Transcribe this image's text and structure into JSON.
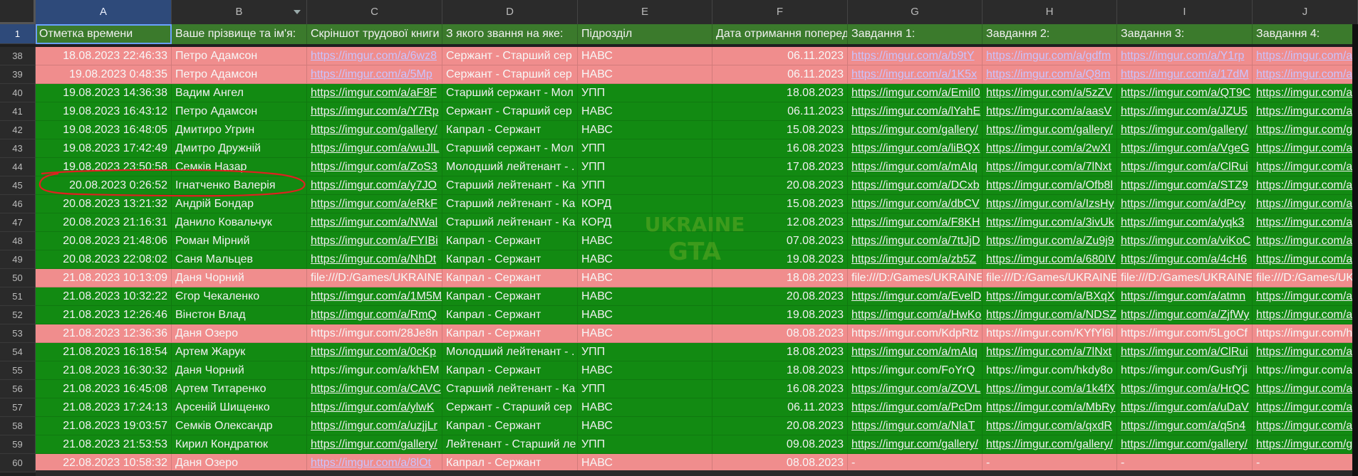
{
  "columns": [
    {
      "letter": "A",
      "selected": true,
      "filter": false
    },
    {
      "letter": "B",
      "selected": false,
      "filter": true
    },
    {
      "letter": "C",
      "selected": false,
      "filter": false
    },
    {
      "letter": "D",
      "selected": false,
      "filter": false
    },
    {
      "letter": "E",
      "selected": false,
      "filter": false
    },
    {
      "letter": "F",
      "selected": false,
      "filter": false
    },
    {
      "letter": "G",
      "selected": false,
      "filter": false
    },
    {
      "letter": "H",
      "selected": false,
      "filter": false
    },
    {
      "letter": "I",
      "selected": false,
      "filter": false
    },
    {
      "letter": "J",
      "selected": false,
      "filter": false
    }
  ],
  "header_row": {
    "num": "1",
    "cells": [
      "Отметка времени",
      "Ваше прізвище та ім'я:",
      "Скріншот трудової книги",
      "З якого звання на яке:",
      "Підрозділ",
      "Дата отримання поперед",
      "Завдання 1:",
      "Завдання 2:",
      "Завдання 3:",
      "Завдання 4:"
    ]
  },
  "colors": {
    "green": "#128a12",
    "pink": "#f08d8d",
    "header": "#3b7a2c",
    "annotation": "#e02020"
  },
  "rows": [
    {
      "num": "38",
      "status": "pink",
      "ts": "18.08.2023 22:46:33",
      "name": "Петро Адамсон",
      "c": "https://imgur.com/a/6wz8",
      "d": "Сержант - Старший сер",
      "e": "НАВС",
      "f": "06.11.2023",
      "g": "https://imgur.com/a/b9tY",
      "h": "https://imgur.com/a/gdfm",
      "i": "https://imgur.com/a/Y1rp",
      "j": "https://imgur.com/a/",
      "link": true
    },
    {
      "num": "39",
      "status": "pink",
      "ts": "19.08.2023 0:48:35",
      "name": "Петро Адамсон",
      "c": "https://imgur.com/a/5Mp",
      "d": "Сержант - Старший сер",
      "e": "НАВС",
      "f": "06.11.2023",
      "g": "https://imgur.com/a/1K5x",
      "h": "https://imgur.com/a/Q8m",
      "i": "https://imgur.com/a/17dM",
      "j": "https://imgur.com/a/",
      "link": true
    },
    {
      "num": "40",
      "status": "green",
      "ts": "19.08.2023 14:36:38",
      "name": "Вадим Ангел",
      "c": "https://imgur.com/a/aF8F",
      "d": "Старший сержант - Мол",
      "e": "УПП",
      "f": "18.08.2023",
      "g": "https://imgur.com/a/EmiI0",
      "h": "https://imgur.com/a/5zZV",
      "i": "https://imgur.com/a/QT9C",
      "j": "https://imgur.com/a/",
      "link": true
    },
    {
      "num": "41",
      "status": "green",
      "ts": "19.08.2023 16:43:12",
      "name": "Петро Адамсон",
      "c": "https://imgur.com/a/Y7Rp",
      "d": "Сержант - Старший сер",
      "e": "НАВС",
      "f": "06.11.2023",
      "g": "https://imgur.com/a/lYahE",
      "h": "https://imgur.com/a/aasV",
      "i": "https://imgur.com/a/JZU5",
      "j": "https://imgur.com/a/",
      "link": true
    },
    {
      "num": "42",
      "status": "green",
      "ts": "19.08.2023 16:48:05",
      "name": "Дмитиро Угрин",
      "c": "https://imgur.com/gallery/",
      "d": "Капрал - Сержант",
      "e": "НАВС",
      "f": "15.08.2023",
      "g": "https://imgur.com/gallery/",
      "h": "https://imgur.com/gallery/",
      "i": "https://imgur.com/gallery/",
      "j": "https://imgur.com/g",
      "link": true
    },
    {
      "num": "43",
      "status": "green",
      "ts": "19.08.2023 17:42:49",
      "name": "Дмитро Дружній",
      "c": "https://imgur.com/a/wuJlL",
      "d": "Старший сержант - Мол",
      "e": "УПП",
      "f": "16.08.2023",
      "g": "https://imgur.com/a/liBQX",
      "h": "https://imgur.com/a/2wXI",
      "i": "https://imgur.com/a/VgeG",
      "j": "https://imgur.com/a/",
      "link": true
    },
    {
      "num": "44",
      "status": "green",
      "ts": "19.08.2023 23:50:58",
      "name": "Семків Назар",
      "c": "https://imgur.com/a/ZoS3",
      "d": "Молодший лейтенант - .",
      "e": "УПП",
      "f": "17.08.2023",
      "g": "https://imgur.com/a/mAIq",
      "h": "https://imgur.com/a/7lNxt",
      "i": "https://imgur.com/a/ClRui",
      "j": "https://imgur.com/a/",
      "link": true
    },
    {
      "num": "45",
      "status": "green",
      "ts": "20.08.2023 0:26:52",
      "name": "Ігнатченко Валерія",
      "c": "https://imgur.com/a/y7JO",
      "d": "Старший лейтенант - Ка",
      "e": "УПП",
      "f": "20.08.2023",
      "g": "https://imgur.com/a/DCxb",
      "h": "https://imgur.com/a/Ofb8l",
      "i": "https://imgur.com/a/STZ9",
      "j": "https://imgur.com/a/",
      "link": true
    },
    {
      "num": "46",
      "status": "green",
      "ts": "20.08.2023 13:21:32",
      "name": "Андрій Бондар",
      "c": "https://imgur.com/a/eRkF",
      "d": "Старший лейтенант - Ка",
      "e": "КОРД",
      "f": "15.08.2023",
      "g": "https://imgur.com/a/dbCV",
      "h": "https://imgur.com/a/IzsHy",
      "i": "https://imgur.com/a/dPcy",
      "j": "https://imgur.com/a/",
      "link": true
    },
    {
      "num": "47",
      "status": "green",
      "ts": "20.08.2023 21:16:31",
      "name": "Данило Ковальчук",
      "c": "https://imgur.com/a/NWal",
      "d": "Старший лейтенант - Ка",
      "e": "КОРД",
      "f": "12.08.2023",
      "g": "https://imgur.com/a/F8KH",
      "h": "https://imgur.com/a/3ivUk",
      "i": "https://imgur.com/a/yqk3",
      "j": "https://imgur.com/a/",
      "link": true
    },
    {
      "num": "48",
      "status": "green",
      "ts": "20.08.2023 21:48:06",
      "name": "Роман Мірний",
      "c": "https://imgur.com/a/FYIBi",
      "d": "Капрал - Сержант",
      "e": "НАВС",
      "f": "07.08.2023",
      "g": "https://imgur.com/a/7ttJjD",
      "h": "https://imgur.com/a/Zu9j9",
      "i": "https://imgur.com/a/viKoC",
      "j": "https://imgur.com/a/",
      "link": true
    },
    {
      "num": "49",
      "status": "green",
      "ts": "20.08.2023 22:08:02",
      "name": "Саня Мальцев",
      "c": "https://imgur.com/a/NhDt",
      "d": "Капрал - Сержант",
      "e": "НАВС",
      "f": "19.08.2023",
      "g": "https://imgur.com/a/zb5Z",
      "h": "https://imgur.com/a/680IV",
      "i": "https://imgur.com/a/4cH6",
      "j": "https://imgur.com/a/",
      "link": true
    },
    {
      "num": "50",
      "status": "pink",
      "ts": "21.08.2023 10:13:09",
      "name": "Даня Чорний",
      "c": "file:///D:/Games/UKRAINE",
      "d": "Капрал - Сержант",
      "e": "НАВС",
      "f": "18.08.2023",
      "g": "file:///D:/Games/UKRAINE",
      "h": "file:///D:/Games/UKRAINE",
      "i": "file:///D:/Games/UKRAINE",
      "j": "file:///D:/Games/UK",
      "link": false
    },
    {
      "num": "51",
      "status": "green",
      "ts": "21.08.2023 10:32:22",
      "name": "Єгор Чекаленко",
      "c": "https://imgur.com/a/1M5M",
      "d": "Капрал - Сержант",
      "e": "НАВС",
      "f": "20.08.2023",
      "g": "https://imgur.com/a/EvelDp",
      "h": "https://imgur.com/a/BXqX",
      "i": "https://imgur.com/a/atmn",
      "j": "https://imgur.com/a/",
      "link": true
    },
    {
      "num": "52",
      "status": "green",
      "ts": "21.08.2023 12:26:46",
      "name": "Вінстон Влад",
      "c": "https://imgur.com/a/RmQ",
      "d": "Капрал - Сержант",
      "e": "НАВС",
      "f": "19.08.2023",
      "g": "https://imgur.com/a/HwKo",
      "h": "https://imgur.com/a/NDSZ",
      "i": "https://imgur.com/a/ZjfWy",
      "j": "https://imgur.com/a/",
      "link": true
    },
    {
      "num": "53",
      "status": "pink",
      "ts": "21.08.2023 12:36:36",
      "name": "Даня Озеро",
      "c": "https://imgur.com/28Je8n",
      "d": "Капрал - Сержант",
      "e": "НАВС",
      "f": "08.08.2023",
      "g": "https://imgur.com/KdpRtz",
      "h": "https://imgur.com/KYfYl6l",
      "i": "https://imgur.com/5LgoCf",
      "j": "https://imgur.com/h",
      "link": false
    },
    {
      "num": "54",
      "status": "green",
      "ts": "21.08.2023 16:18:54",
      "name": "Артем Жарук",
      "c": "https://imgur.com/a/0cKp",
      "d": "Молодший лейтенант - .",
      "e": "УПП",
      "f": "18.08.2023",
      "g": "https://imgur.com/a/mAIq",
      "h": "https://imgur.com/a/7lNxt",
      "i": "https://imgur.com/a/ClRui",
      "j": "https://imgur.com/a/",
      "link": true
    },
    {
      "num": "55",
      "status": "green",
      "ts": "21.08.2023 16:30:32",
      "name": "Даня Чорний",
      "c": "https://imgur.com/a/khEM",
      "d": "Капрал - Сержант",
      "e": "НАВС",
      "f": "18.08.2023",
      "g": "https://imgur.com/FoYrQ",
      "h": "https://imgur.com/hkdy8o",
      "i": "https://imgur.com/GusfYji",
      "j": "https://imgur.com/a/",
      "link": false
    },
    {
      "num": "56",
      "status": "green",
      "ts": "21.08.2023 16:45:08",
      "name": "Артем Титаренко",
      "c": "https://imgur.com/a/CAVC",
      "d": "Старший лейтенант - Ка",
      "e": "УПП",
      "f": "16.08.2023",
      "g": "https://imgur.com/a/ZOVL",
      "h": "https://imgur.com/a/1k4fX",
      "i": "https://imgur.com/a/HrQC",
      "j": "https://imgur.com/a/",
      "link": true
    },
    {
      "num": "57",
      "status": "green",
      "ts": "21.08.2023 17:24:13",
      "name": "Арсеній Шищенко",
      "c": "https://imgur.com/a/ylwK",
      "d": "Сержант - Старший сер",
      "e": "НАВС",
      "f": "06.11.2023",
      "g": "https://imgur.com/a/PcDm",
      "h": "https://imgur.com/a/MbRy",
      "i": "https://imgur.com/a/uDaV",
      "j": "https://imgur.com/a/",
      "link": true
    },
    {
      "num": "58",
      "status": "green",
      "ts": "21.08.2023 19:03:57",
      "name": "Семків Олександр",
      "c": "https://imgur.com/a/uzjjLr",
      "d": "Капрал - Сержант",
      "e": "НАВС",
      "f": "20.08.2023",
      "g": "https://imgur.com/a/NlaT",
      "h": "https://imgur.com/a/qxdR",
      "i": "https://imgur.com/a/q5n4",
      "j": "https://imgur.com/a/",
      "link": true
    },
    {
      "num": "59",
      "status": "green",
      "ts": "21.08.2023 21:53:53",
      "name": "Кирил Кондратюк",
      "c": "https://imgur.com/gallery/",
      "d": "Лейтенант - Старший ле",
      "e": "УПП",
      "f": "09.08.2023",
      "g": "https://imgur.com/gallery/",
      "h": "https://imgur.com/gallery/",
      "i": "https://imgur.com/gallery/",
      "j": "https://imgur.com/g",
      "link": true
    },
    {
      "num": "60",
      "status": "pink",
      "ts": "22.08.2023 10:58:32",
      "name": "Даня Озеро",
      "c": "https://imgur.com/a/8lOt",
      "d": "Капрал - Сержант",
      "e": "НАВС",
      "f": "08.08.2023",
      "g": "-",
      "h": "-",
      "i": "-",
      "j": "-",
      "link": true
    }
  ],
  "watermark": {
    "line1": "UKRAINE",
    "line2": "GTA"
  }
}
